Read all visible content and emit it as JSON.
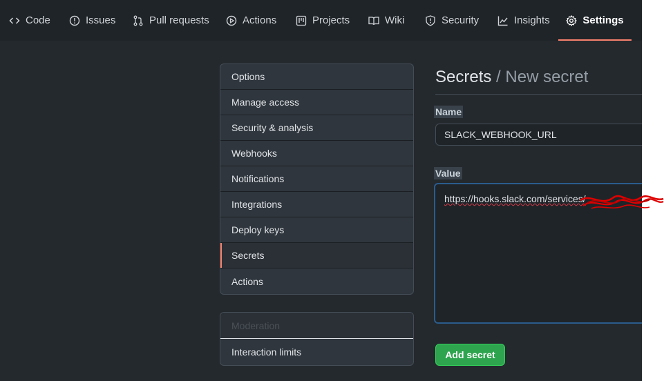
{
  "nav": {
    "tabs": [
      {
        "label": "Code",
        "icon": "code-icon"
      },
      {
        "label": "Issues",
        "icon": "issue-opened-icon"
      },
      {
        "label": "Pull requests",
        "icon": "git-pull-request-icon"
      },
      {
        "label": "Actions",
        "icon": "play-icon"
      },
      {
        "label": "Projects",
        "icon": "project-icon"
      },
      {
        "label": "Wiki",
        "icon": "book-icon"
      },
      {
        "label": "Security",
        "icon": "shield-icon"
      },
      {
        "label": "Insights",
        "icon": "graph-icon"
      },
      {
        "label": "Settings",
        "icon": "gear-icon",
        "active": true
      }
    ]
  },
  "sidebar": {
    "items": [
      {
        "label": "Options"
      },
      {
        "label": "Manage access"
      },
      {
        "label": "Security & analysis"
      },
      {
        "label": "Webhooks"
      },
      {
        "label": "Notifications"
      },
      {
        "label": "Integrations"
      },
      {
        "label": "Deploy keys"
      },
      {
        "label": "Secrets",
        "selected": true
      },
      {
        "label": "Actions"
      }
    ],
    "moderation": {
      "heading": "Moderation",
      "items": [
        {
          "label": "Interaction limits"
        }
      ]
    }
  },
  "main": {
    "title": "Secrets",
    "title_separator": " / ",
    "subtitle": "New secret",
    "name_label": "Name",
    "name_value": "SLACK_WEBHOOK_URL",
    "value_label": "Value",
    "value_text": "https://hooks.slack.com/services/",
    "submit_label": "Add secret"
  },
  "colors": {
    "accent_underline": "#f9826c",
    "primary_button": "#2ea44f",
    "redaction": "#e00000"
  }
}
